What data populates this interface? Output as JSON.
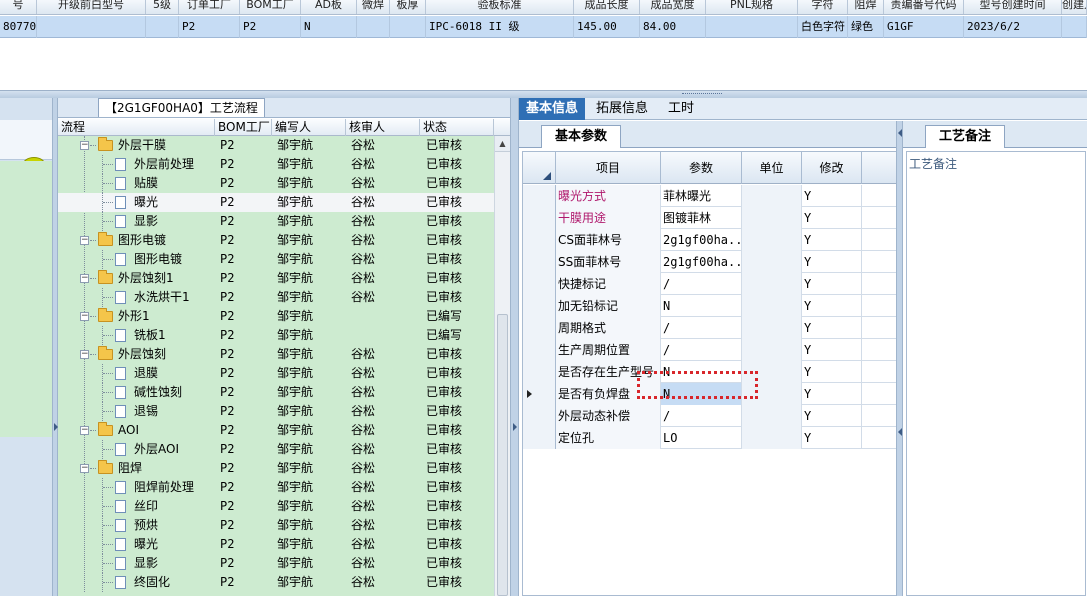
{
  "top_grid": {
    "headers": [
      "号",
      "开级前白型号",
      "5级",
      "订单工厂",
      "BOM工厂",
      "AD板",
      "微焊",
      "板厚",
      "验板标准",
      "成品长度",
      "成品宽度",
      "PNL规格",
      "字符",
      "阻焊",
      "责编番号代码",
      "型号创建时间",
      "创建人"
    ],
    "row": [
      "80770",
      "",
      "",
      "P2",
      "P2",
      "N",
      "",
      "",
      "IPC-6018 II 级",
      "145.00",
      "84.00",
      "",
      "白色字符",
      "绿色",
      "G1GF",
      "2023/6/2",
      ""
    ]
  },
  "tree": {
    "caption": "【2G1GF00HA0】工艺流程",
    "headers": {
      "flow": "流程",
      "bom": "BOM工厂",
      "writer": "编写人",
      "reviewer": "核审人",
      "status": "状态"
    },
    "rows": [
      {
        "level": 0,
        "name": "外层干膜",
        "bom": "P2",
        "writer": "邹宇航",
        "reviewer": "谷松",
        "status": "已审核"
      },
      {
        "level": 1,
        "name": "外层前处理",
        "bom": "P2",
        "writer": "邹宇航",
        "reviewer": "谷松",
        "status": "已审核"
      },
      {
        "level": 1,
        "name": "贴膜",
        "bom": "P2",
        "writer": "邹宇航",
        "reviewer": "谷松",
        "status": "已审核"
      },
      {
        "level": 1,
        "name": "曝光",
        "bom": "P2",
        "writer": "邹宇航",
        "reviewer": "谷松",
        "status": "已审核",
        "selected": true
      },
      {
        "level": 1,
        "name": "显影",
        "bom": "P2",
        "writer": "邹宇航",
        "reviewer": "谷松",
        "status": "已审核"
      },
      {
        "level": 0,
        "name": "图形电镀",
        "bom": "P2",
        "writer": "邹宇航",
        "reviewer": "谷松",
        "status": "已审核"
      },
      {
        "level": 1,
        "name": "图形电镀",
        "bom": "P2",
        "writer": "邹宇航",
        "reviewer": "谷松",
        "status": "已审核"
      },
      {
        "level": 0,
        "name": "外层蚀刻1",
        "bom": "P2",
        "writer": "邹宇航",
        "reviewer": "谷松",
        "status": "已审核"
      },
      {
        "level": 1,
        "name": "水洗烘干1",
        "bom": "P2",
        "writer": "邹宇航",
        "reviewer": "谷松",
        "status": "已审核"
      },
      {
        "level": 0,
        "name": "外形1",
        "bom": "P2",
        "writer": "邹宇航",
        "reviewer": "",
        "status": "已编写"
      },
      {
        "level": 1,
        "name": "铣板1",
        "bom": "P2",
        "writer": "邹宇航",
        "reviewer": "",
        "status": "已编写"
      },
      {
        "level": 0,
        "name": "外层蚀刻",
        "bom": "P2",
        "writer": "邹宇航",
        "reviewer": "谷松",
        "status": "已审核"
      },
      {
        "level": 1,
        "name": "退膜",
        "bom": "P2",
        "writer": "邹宇航",
        "reviewer": "谷松",
        "status": "已审核"
      },
      {
        "level": 1,
        "name": "碱性蚀刻",
        "bom": "P2",
        "writer": "邹宇航",
        "reviewer": "谷松",
        "status": "已审核"
      },
      {
        "level": 1,
        "name": "退锡",
        "bom": "P2",
        "writer": "邹宇航",
        "reviewer": "谷松",
        "status": "已审核"
      },
      {
        "level": 0,
        "name": "AOI",
        "bom": "P2",
        "writer": "邹宇航",
        "reviewer": "谷松",
        "status": "已审核"
      },
      {
        "level": 1,
        "name": "外层AOI",
        "bom": "P2",
        "writer": "邹宇航",
        "reviewer": "谷松",
        "status": "已审核"
      },
      {
        "level": 0,
        "name": "阻焊",
        "bom": "P2",
        "writer": "邹宇航",
        "reviewer": "谷松",
        "status": "已审核"
      },
      {
        "level": 1,
        "name": "阻焊前处理",
        "bom": "P2",
        "writer": "邹宇航",
        "reviewer": "谷松",
        "status": "已审核"
      },
      {
        "level": 1,
        "name": "丝印",
        "bom": "P2",
        "writer": "邹宇航",
        "reviewer": "谷松",
        "status": "已审核"
      },
      {
        "level": 1,
        "name": "预烘",
        "bom": "P2",
        "writer": "邹宇航",
        "reviewer": "谷松",
        "status": "已审核"
      },
      {
        "level": 1,
        "name": "曝光",
        "bom": "P2",
        "writer": "邹宇航",
        "reviewer": "谷松",
        "status": "已审核"
      },
      {
        "level": 1,
        "name": "显影",
        "bom": "P2",
        "writer": "邹宇航",
        "reviewer": "谷松",
        "status": "已审核"
      },
      {
        "level": 1,
        "name": "终固化",
        "bom": "P2",
        "writer": "邹宇航",
        "reviewer": "谷松",
        "status": "已审核"
      }
    ]
  },
  "tabs": {
    "basic": "基本信息",
    "extended": "拓展信息",
    "hours": "工时"
  },
  "subtab": "基本参数",
  "params": {
    "headers": {
      "item": "项目",
      "param": "参数",
      "unit": "单位",
      "modify": "修改"
    },
    "rows": [
      {
        "item": "曝光方式",
        "param": "菲林曝光",
        "unit": "",
        "modify": "Y",
        "highlight": true
      },
      {
        "item": "干膜用途",
        "param": "图镀菲林",
        "unit": "",
        "modify": "Y",
        "highlight": true
      },
      {
        "item": "CS面菲林号",
        "param": "2g1gf00ha...",
        "unit": "",
        "modify": "Y"
      },
      {
        "item": "SS面菲林号",
        "param": "2g1gf00ha...",
        "unit": "",
        "modify": "Y"
      },
      {
        "item": "快捷标记",
        "param": "/",
        "unit": "",
        "modify": "Y"
      },
      {
        "item": "加无铅标记",
        "param": "N",
        "unit": "",
        "modify": "Y"
      },
      {
        "item": "周期格式",
        "param": "/",
        "unit": "",
        "modify": "Y"
      },
      {
        "item": "生产周期位置",
        "param": "/",
        "unit": "",
        "modify": "Y"
      },
      {
        "item": "是否存在生产型号",
        "param": "N",
        "unit": "",
        "modify": "Y"
      },
      {
        "item": "是否有负焊盘",
        "param": "N",
        "unit": "",
        "modify": "Y",
        "current": true
      },
      {
        "item": "外层动态补偿",
        "param": "/",
        "unit": "",
        "modify": "Y"
      },
      {
        "item": "定位孔",
        "param": "LO",
        "unit": "",
        "modify": "Y"
      }
    ]
  },
  "notes": {
    "tab": "工艺备注",
    "label": "工艺备注"
  },
  "colors": {
    "tab_active": "#2f6fb5",
    "tree_green": "#cdebd0",
    "row_selected": "#c6dcf4",
    "highlight_text": "#b0186c",
    "focus_box": "#d8262b"
  }
}
